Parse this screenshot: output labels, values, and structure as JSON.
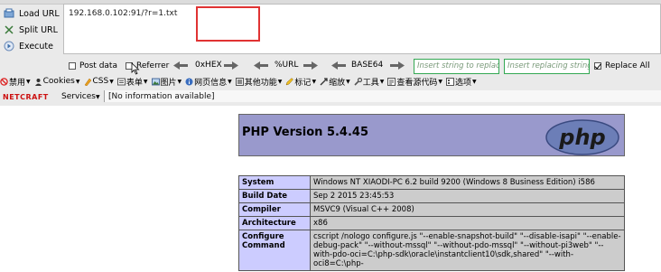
{
  "hackbar": {
    "load_url": "Load URL",
    "split_url": "Split URL",
    "execute": "Execute",
    "url_value": "192.168.0.102:91/?r=1.txt",
    "post_data": "Post data",
    "referrer": "Referrer",
    "hex": "0xHEX",
    "url_enc": "%URL",
    "base64": "BASE64",
    "insert_placeholder": "Insert string to replace",
    "replacing_placeholder": "Insert replacing string",
    "replace_all": "Replace All",
    "replace_all_checked": true
  },
  "webdev_menu": [
    {
      "label": "禁用",
      "icon": "disable-icon"
    },
    {
      "label": "Cookies",
      "icon": "cookie-icon"
    },
    {
      "label": "CSS",
      "icon": "css-icon"
    },
    {
      "label": "表单",
      "icon": "form-icon"
    },
    {
      "label": "图片",
      "icon": "image-icon"
    },
    {
      "label": "网页信息",
      "icon": "info-icon"
    },
    {
      "label": "其他功能",
      "icon": "misc-icon"
    },
    {
      "label": "标记",
      "icon": "marker-icon"
    },
    {
      "label": "缩放",
      "icon": "zoom-icon"
    },
    {
      "label": "工具",
      "icon": "tools-icon"
    },
    {
      "label": "查看源代码",
      "icon": "source-icon"
    },
    {
      "label": "选项",
      "icon": "options-icon"
    }
  ],
  "netcraft": {
    "logo_text": "NETCRAFT",
    "services": "Services",
    "info": "[No information available]"
  },
  "phpinfo": {
    "title": "PHP Version 5.4.45",
    "logo_text": "php",
    "rows": [
      {
        "key": "System",
        "value": "Windows NT XIAODI-PC 6.2 build 9200 (Windows 8 Business Edition) i586"
      },
      {
        "key": "Build Date",
        "value": "Sep 2 2015 23:45:53"
      },
      {
        "key": "Compiler",
        "value": "MSVC9 (Visual C++ 2008)"
      },
      {
        "key": "Architecture",
        "value": "x86"
      },
      {
        "key": "Configure Command",
        "value": "cscript /nologo configure.js \"--enable-snapshot-build\" \"--disable-isapi\" \"--enable-debug-pack\" \"--without-mssql\" \"--without-pdo-mssql\" \"--without-pi3web\" \"--with-pdo-oci=C:\\php-sdk\\oracle\\instantclient10\\sdk,shared\" \"--with-oci8=C:\\php-"
      }
    ]
  },
  "colors": {
    "php_header": "#9999cc",
    "php_key": "#ccccff",
    "php_value": "#cccccc",
    "highlight": "#e03333",
    "green_border": "#34a853"
  }
}
